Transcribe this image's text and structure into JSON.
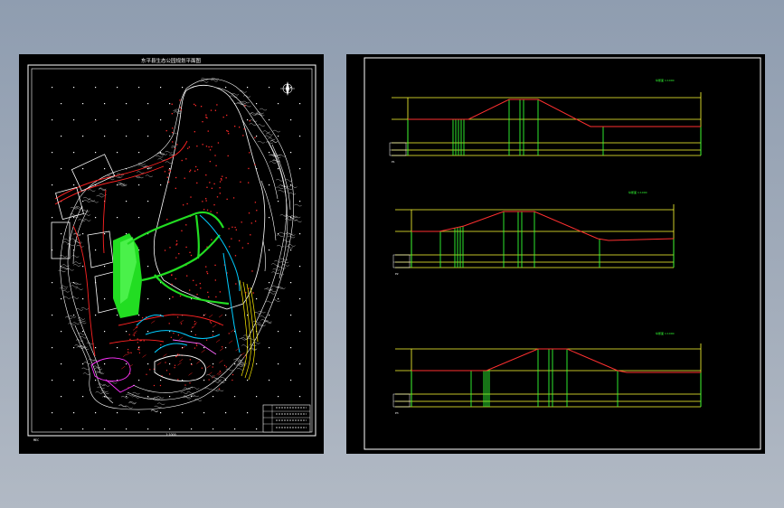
{
  "left_drawing": {
    "title": "东平县生态公园规划平面图",
    "scale_note": "1:1000",
    "sheet_code": "MEC",
    "legend_rows": 4
  },
  "right_drawing": {
    "profiles": [
      {
        "id": "profile-1",
        "caption": "纵断面 1:1000",
        "tag": "P1"
      },
      {
        "id": "profile-2",
        "caption": "纵断面 1:1000",
        "tag": "P2"
      },
      {
        "id": "profile-3",
        "caption": "纵断面 1:1000",
        "tag": "P3"
      }
    ]
  },
  "colors": {
    "background": "#000000",
    "frame": "#ffffff",
    "ground_line": "#ff3030",
    "grid_yellow": "#ffff33",
    "station_green": "#33ff33",
    "contour": "#ffffff",
    "landscape_green": "#22dd22",
    "road_red": "#ff2222",
    "water_cyan": "#00ccff",
    "yellow_contour": "#ffee00"
  }
}
